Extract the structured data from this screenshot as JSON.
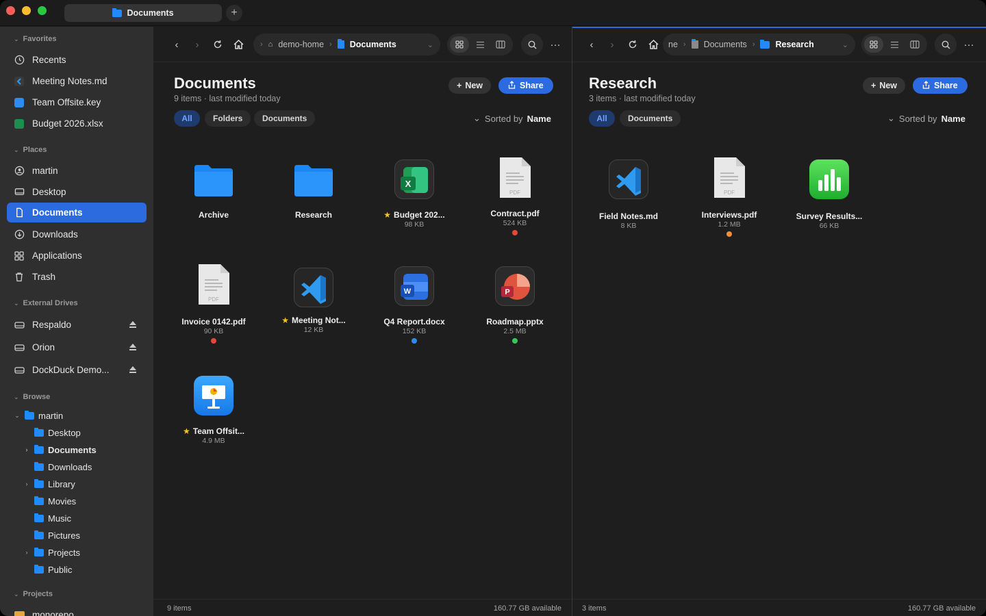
{
  "window": {
    "tab_title": "Documents",
    "new_tab": "+"
  },
  "sidebar": {
    "favorites": {
      "header": "Favorites",
      "items": [
        {
          "label": "Recents",
          "icon": "clock-icon"
        },
        {
          "label": "Meeting Notes.md",
          "icon": "vscode-file-icon"
        },
        {
          "label": "Team Offsite.key",
          "icon": "keynote-file-icon"
        },
        {
          "label": "Budget 2026.xlsx",
          "icon": "excel-file-icon"
        }
      ]
    },
    "places": {
      "header": "Places",
      "items": [
        {
          "label": "martin",
          "icon": "person-icon"
        },
        {
          "label": "Desktop",
          "icon": "desktop-icon"
        },
        {
          "label": "Documents",
          "icon": "document-icon"
        },
        {
          "label": "Downloads",
          "icon": "download-icon"
        },
        {
          "label": "Applications",
          "icon": "apps-grid-icon"
        },
        {
          "label": "Trash",
          "icon": "trash-icon"
        }
      ]
    },
    "external": {
      "header": "External Drives",
      "items": [
        {
          "label": "Respaldo"
        },
        {
          "label": "Orion"
        },
        {
          "label": "DockDuck Demo..."
        }
      ]
    },
    "browse": {
      "header": "Browse",
      "root": "martin",
      "children": [
        "Desktop",
        "Documents",
        "Downloads",
        "Library",
        "Movies",
        "Music",
        "Pictures",
        "Projects",
        "Public"
      ]
    },
    "projects": {
      "header": "Projects",
      "items": [
        "monorepo"
      ]
    }
  },
  "left": {
    "crumbs": [
      "demo-home",
      "Documents"
    ],
    "title": "Documents",
    "subtitle": "9 items · last modified today",
    "new_label": "New",
    "share_label": "Share",
    "filters": [
      "All",
      "Folders",
      "Documents"
    ],
    "sorted_prefix": "Sorted by",
    "sorted_key": "Name",
    "items": [
      {
        "name": "Archive",
        "size": "",
        "icon": "folder-icon"
      },
      {
        "name": "Research",
        "size": "",
        "icon": "folder-icon"
      },
      {
        "name": "Budget 202...",
        "size": "98 KB",
        "icon": "excel-icon",
        "starred": true
      },
      {
        "name": "Contract.pdf",
        "size": "524 KB",
        "icon": "pdf-icon",
        "tag": "#e5483b"
      },
      {
        "name": "Invoice 0142.pdf",
        "size": "90 KB",
        "icon": "pdf-icon",
        "tag": "#e5483b"
      },
      {
        "name": "Meeting Not...",
        "size": "12 KB",
        "icon": "vscode-icon",
        "starred": true
      },
      {
        "name": "Q4 Report.docx",
        "size": "152 KB",
        "icon": "word-icon",
        "tag": "#2f8bea"
      },
      {
        "name": "Roadmap.pptx",
        "size": "2.5 MB",
        "icon": "powerpoint-icon",
        "tag": "#35c759"
      },
      {
        "name": "Team Offsit...",
        "size": "4.9 MB",
        "icon": "keynote-icon",
        "starred": true
      }
    ],
    "status_left": "9 items",
    "status_right": "160.77 GB available"
  },
  "right": {
    "crumbs": [
      "ne",
      "Documents",
      "Research"
    ],
    "title": "Research",
    "subtitle": "3 items · last modified today",
    "new_label": "New",
    "share_label": "Share",
    "filters": [
      "All",
      "Documents"
    ],
    "sorted_prefix": "Sorted by",
    "sorted_key": "Name",
    "items": [
      {
        "name": "Field Notes.md",
        "size": "8 KB",
        "icon": "vscode-icon"
      },
      {
        "name": "Interviews.pdf",
        "size": "1.2 MB",
        "icon": "pdf-icon",
        "tag": "#f0903a"
      },
      {
        "name": "Survey Results...",
        "size": "66 KB",
        "icon": "numbers-icon"
      }
    ],
    "status_left": "3 items",
    "status_right": "160.77 GB available"
  }
}
